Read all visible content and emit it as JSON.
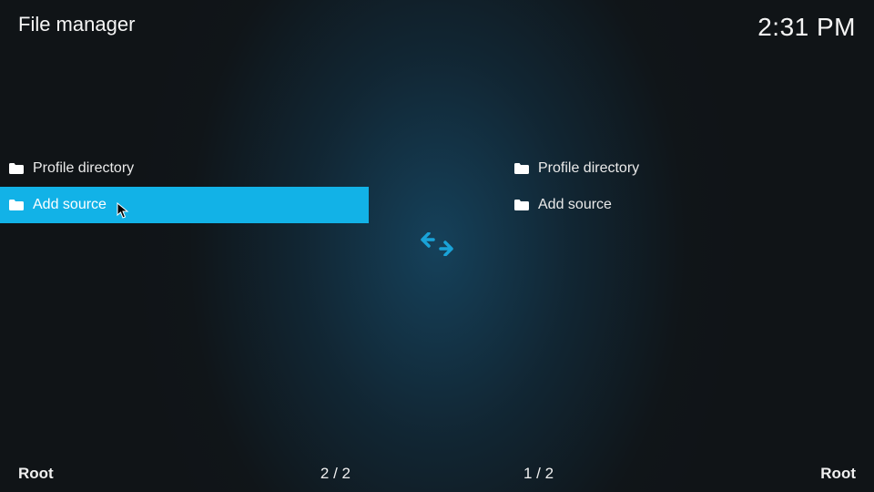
{
  "header": {
    "title": "File manager",
    "clock": "2:31 PM"
  },
  "left": {
    "items": [
      {
        "label": "Profile directory"
      },
      {
        "label": "Add source"
      }
    ],
    "footer": {
      "path": "Root",
      "count": "2 / 2"
    }
  },
  "right": {
    "items": [
      {
        "label": "Profile directory"
      },
      {
        "label": "Add source"
      }
    ],
    "footer": {
      "path": "Root",
      "count": "1 / 2"
    }
  }
}
